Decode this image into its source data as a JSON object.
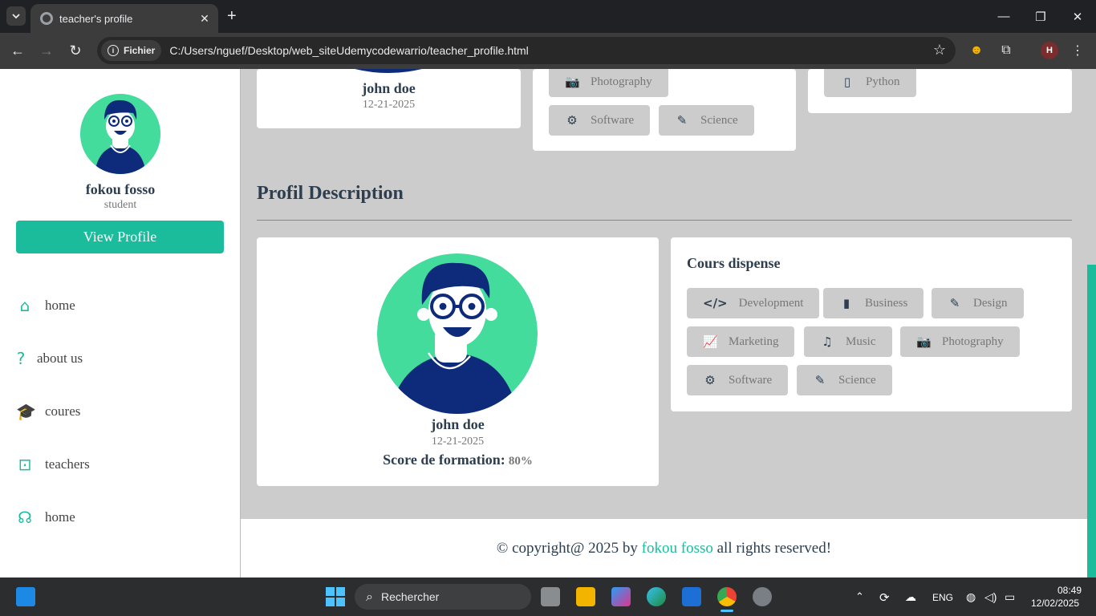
{
  "browser": {
    "tab_title": "teacher's profile",
    "tab_close": "✕",
    "new_tab": "+",
    "min": "—",
    "max": "❐",
    "close": "✕",
    "security_chip": "Fichier",
    "url": "C:/Users/nguef/Desktop/web_siteUdemycodewarrio/teacher_profile.html",
    "profile_initial": "H"
  },
  "sidebar": {
    "name": "fokou fosso",
    "role": "student",
    "view_profile": "View Profile",
    "nav": [
      {
        "icon": "⌂",
        "label": "home"
      },
      {
        "icon": "?",
        "label": "about us"
      },
      {
        "icon": "🎓",
        "label": "coures"
      },
      {
        "icon": "⊡",
        "label": "teachers"
      },
      {
        "icon": "☊",
        "label": "home"
      }
    ]
  },
  "top_cards": {
    "teacher_name": "john doe",
    "teacher_date": "12-21-2025",
    "middle_tags": [
      {
        "icon": "📷",
        "label": "Photography"
      },
      {
        "icon": "⚙",
        "label": "Software"
      },
      {
        "icon": "✎",
        "label": "Science"
      }
    ],
    "right_tags": [
      {
        "icon": "▯",
        "label": "Python"
      }
    ]
  },
  "profile": {
    "section_title": "Profil Description",
    "name": "john doe",
    "date": "12-21-2025",
    "score_label": "Score de formation:",
    "score_value": "80%"
  },
  "courses": {
    "title": "Cours dispense",
    "tags": [
      {
        "icon": "</>",
        "label": "Development"
      },
      {
        "icon": "▮",
        "label": "Business"
      },
      {
        "icon": "✎",
        "label": "Design"
      },
      {
        "icon": "📈",
        "label": "Marketing"
      },
      {
        "icon": "♫",
        "label": "Music"
      },
      {
        "icon": "📷",
        "label": "Photography"
      },
      {
        "icon": "⚙",
        "label": "Software"
      },
      {
        "icon": "✎",
        "label": "Science"
      }
    ]
  },
  "footer": {
    "prefix": "© copyright@ 2025 by",
    "author": "fokou fosso",
    "suffix": "all rights reserved!"
  },
  "taskbar": {
    "search_placeholder": "Rechercher",
    "lang": "ENG",
    "time": "08:49",
    "date": "12/02/2025"
  },
  "colors": {
    "accent": "#1abc9c",
    "heading": "#2c3e50",
    "avatar_bg": "#44dc9c",
    "avatar_shirt": "#0d2b7a"
  }
}
